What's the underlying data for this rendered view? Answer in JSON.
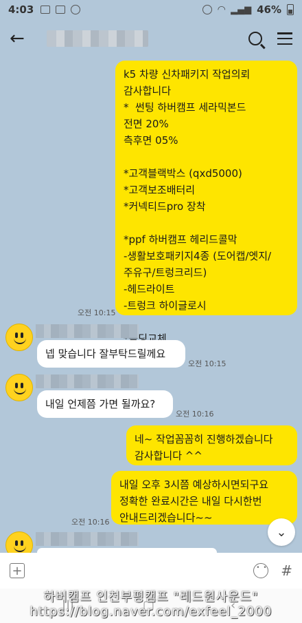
{
  "status_bar": {
    "time": "4:03",
    "battery": "46%"
  },
  "messages": [
    {
      "text": "k5 차량 신차패키지 작업의뢰\n감사합니다\n*  썬팅 하버캠프 세라믹본드\n전면 20%\n측후면 05%\n\n*고객블랙박스 (qxd5000)\n*고객보조배터리\n*커넥티드pro 장착\n\n*ppf 하버캠프 헤리드콜막\n-생활보호패키지4종 (도어캡/엣지/\n주유구/트렁크리드)\n-헤드라이트\n-트렁크 하이글로시\n\n*몰딩교체",
      "time": "오전 10:15"
    },
    {
      "text": "넵 맞습니다 잘부탁드릴께요",
      "time": "오전 10:15"
    },
    {
      "text": "내일 언제쯤 가면 될까요?",
      "time": "오전 10:16"
    },
    {
      "text": "네~ 작업꼼꼼히 진행하겠습니다\n감사합니다 ^^"
    },
    {
      "text": "내일 오후 3시쯤 예상하시면되구요\n정확한 완료시간은 내일 다시한번\n안내드리겠습니다~~",
      "time": "오전 10:16"
    }
  ],
  "watermark": {
    "line1": "하버캠프 인천부평캠프 \"레드원사운드\"",
    "line2": "https://blog.naver.com/exfeel_2000"
  },
  "input": {
    "placeholder": ""
  },
  "icons": {
    "back": "arrow-left-icon",
    "search": "search-icon",
    "menu": "menu-icon",
    "scroll": "chevron-down-icon",
    "plus": "plus-icon",
    "emoji": "emoji-icon",
    "hash": "hash-icon"
  }
}
